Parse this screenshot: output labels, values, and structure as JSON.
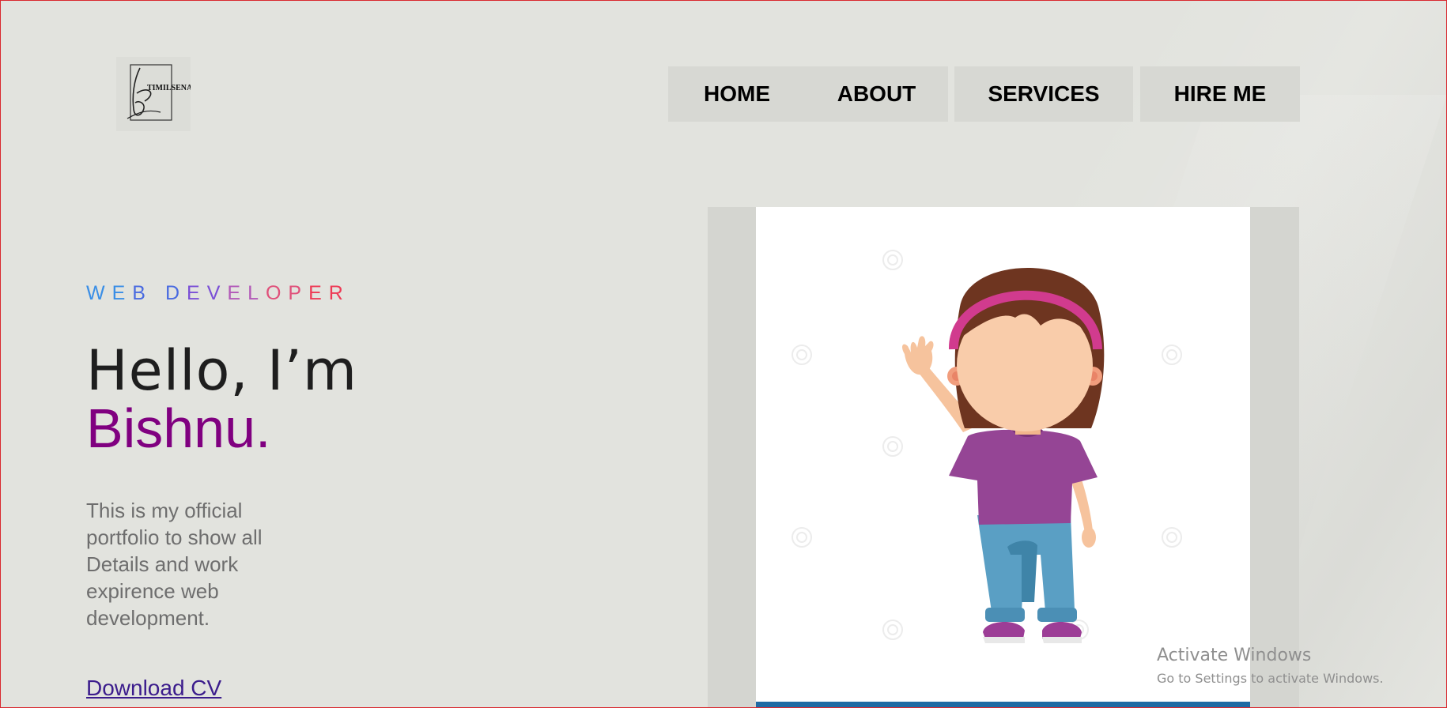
{
  "colors": {
    "background": "#e2e3de",
    "name_accent": "#800080",
    "link": "#3b1c8c",
    "subtitle_gradient": [
      "#3a8ee6",
      "#4a6be0",
      "#7a4fd6",
      "#b259b8",
      "#e0507a",
      "#ee3a55"
    ]
  },
  "logo": {
    "text": "TIMILSENA",
    "icon": "signature-logo-icon"
  },
  "nav": {
    "items": [
      {
        "label": "HOME"
      },
      {
        "label": "ABOUT"
      },
      {
        "label": "SERVICES"
      },
      {
        "label": "HIRE ME"
      }
    ]
  },
  "hero": {
    "subtitle": "WEB DEVELOPER",
    "greeting": "Hello, I’m",
    "name": "Bishnu.",
    "description": "This is my official portfolio to show all Details and work expirence web development.",
    "cta_label": "Download CV"
  },
  "illustration": {
    "icon": "girl-waving-illustration-icon"
  },
  "watermark": {
    "title": "Activate Windows",
    "subtitle": "Go to Settings to activate Windows."
  }
}
